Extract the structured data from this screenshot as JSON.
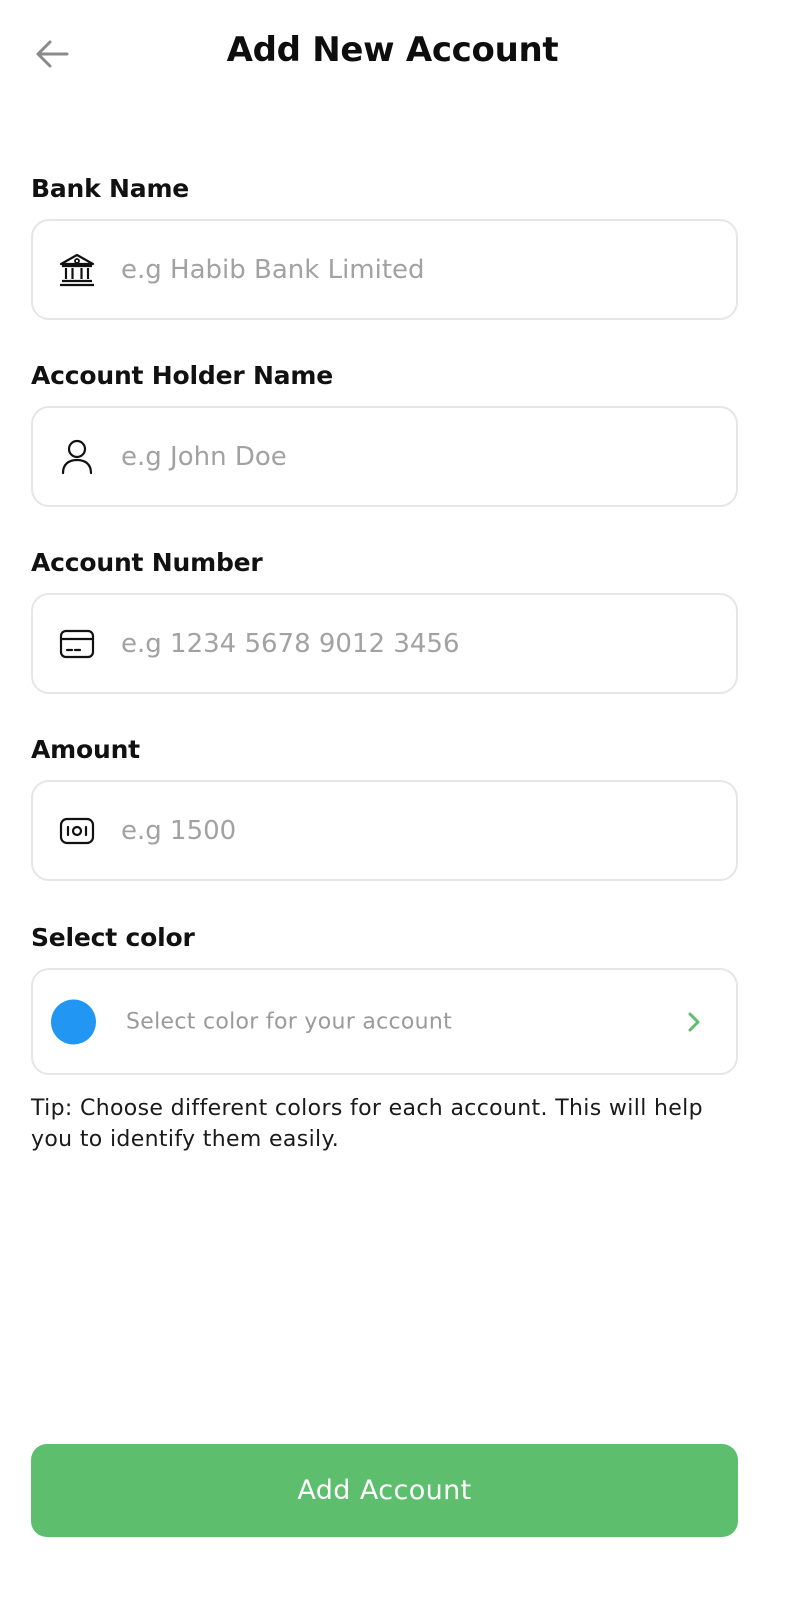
{
  "header": {
    "title": "Add New Account",
    "back_icon": "arrow-left-icon"
  },
  "form": {
    "bank_name": {
      "label": "Bank Name",
      "placeholder": "e.g Habib Bank Limited",
      "value": "",
      "icon": "bank-icon"
    },
    "holder_name": {
      "label": "Account Holder Name",
      "placeholder": "e.g John Doe",
      "value": "",
      "icon": "user-icon"
    },
    "account_number": {
      "label": "Account Number",
      "placeholder": "e.g 1234 5678 9012 3456",
      "value": "",
      "icon": "card-icon"
    },
    "amount": {
      "label": "Amount",
      "placeholder": "e.g 1500",
      "value": "",
      "icon": "cash-icon"
    },
    "color": {
      "label": "Select color",
      "text": "Select color for your account",
      "selected_color": "#2196F3",
      "icon": "chevron-right-icon"
    },
    "tip": "Tip: Choose different colors for each account. This will help you to identify them easily."
  },
  "submit": {
    "label": "Add Account",
    "color": "#5DBF6E"
  },
  "colors": {
    "border": "#E6E6E6",
    "placeholder": "#A2A2A2",
    "accent_green": "#5DBF6E",
    "dot_blue": "#2196F3"
  }
}
